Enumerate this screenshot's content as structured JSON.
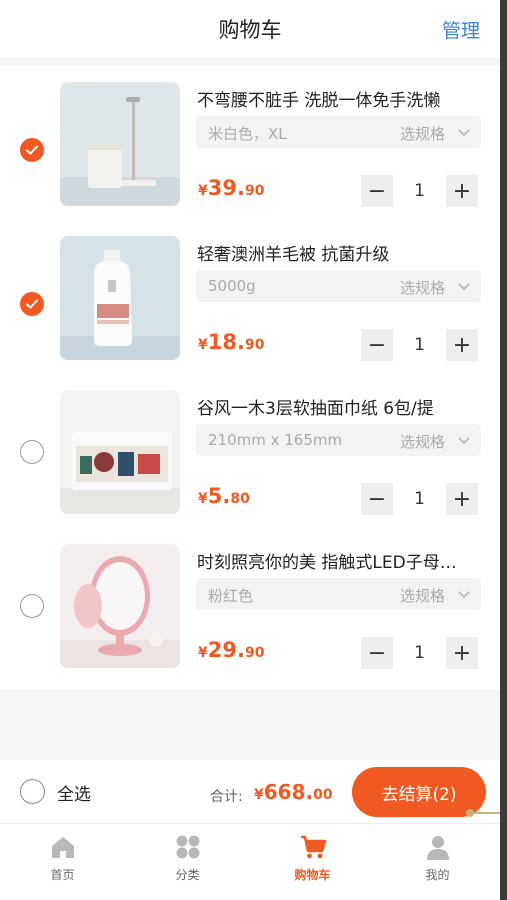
{
  "header": {
    "title": "购物车",
    "manage": "管理"
  },
  "items": [
    {
      "checked": true,
      "name": "不弯腰不脏手 洗脱一体免手洗懒",
      "spec": "米白色，XL",
      "spec_button": "选规格",
      "price_currency": "¥",
      "price_int": "39.",
      "price_dec": "90",
      "qty": "1",
      "image_icon": "mop-bucket-image"
    },
    {
      "checked": true,
      "name": "轻奢澳洲羊毛被 抗菌升级",
      "spec": "5000g",
      "spec_button": "选规格",
      "price_currency": "¥",
      "price_int": "18.",
      "price_dec": "90",
      "qty": "1",
      "image_icon": "detergent-bottle-image"
    },
    {
      "checked": false,
      "name": "谷风一木3层软抽面巾纸 6包/提",
      "spec": "210mm x 165mm",
      "spec_button": "选规格",
      "price_currency": "¥",
      "price_int": "5.",
      "price_dec": "80",
      "qty": "1",
      "image_icon": "tissue-box-image"
    },
    {
      "checked": false,
      "name": "时刻照亮你的美 指触式LED子母…",
      "spec": "粉红色",
      "spec_button": "选规格",
      "price_currency": "¥",
      "price_int": "29.",
      "price_dec": "90",
      "qty": "1",
      "image_icon": "led-mirror-image"
    }
  ],
  "footer": {
    "select_all": "全选",
    "total_label": "合计:",
    "total_currency": "¥",
    "total_int": "668.",
    "total_dec": "00",
    "checkout": "去结算(2)"
  },
  "tabs": [
    {
      "label": "首页",
      "icon": "home-icon",
      "active": false
    },
    {
      "label": "分类",
      "icon": "category-icon",
      "active": false
    },
    {
      "label": "购物车",
      "icon": "cart-icon",
      "active": true
    },
    {
      "label": "我的",
      "icon": "profile-icon",
      "active": false
    }
  ],
  "colors": {
    "accent": "#f05a22",
    "manage": "#3d7fd9",
    "inactive_icon": "#b8b8b8"
  }
}
